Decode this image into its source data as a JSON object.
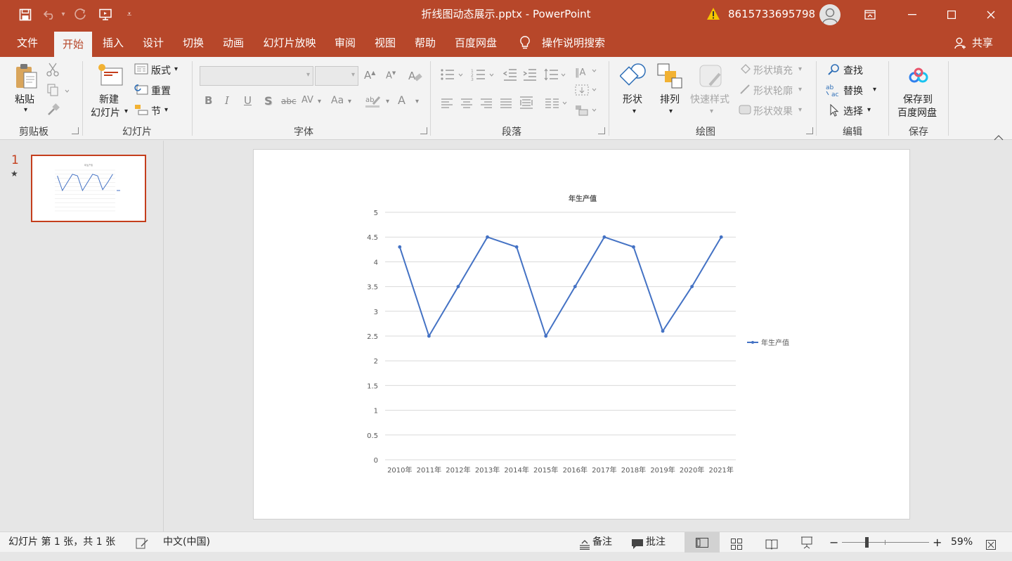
{
  "window": {
    "title": "折线图动态展示.pptx  -  PowerPoint",
    "account": "8615733695798"
  },
  "tabs": [
    "文件",
    "开始",
    "插入",
    "设计",
    "切换",
    "动画",
    "幻灯片放映",
    "审阅",
    "视图",
    "帮助",
    "百度网盘"
  ],
  "active_tab": "开始",
  "tell_me": "操作说明搜索",
  "share": "共享",
  "ribbon": {
    "clipboard": {
      "label": "剪贴板",
      "paste": "粘贴"
    },
    "slides": {
      "label": "幻灯片",
      "new_slide_1": "新建",
      "new_slide_2": "幻灯片",
      "layout": "版式",
      "reset": "重置",
      "section": "节"
    },
    "font": {
      "label": "字体",
      "bold": "B",
      "italic": "I",
      "underline": "U",
      "shadow": "S",
      "strike": "abc",
      "spacing": "AV",
      "case": "Aa",
      "font_color": "A"
    },
    "paragraph": {
      "label": "段落"
    },
    "drawing": {
      "label": "绘图",
      "shapes": "形状",
      "arrange": "排列",
      "quick_styles": "快速样式",
      "fill": "形状填充",
      "outline": "形状轮廓",
      "effects": "形状效果"
    },
    "editing": {
      "label": "编辑",
      "find": "查找",
      "replace": "替换",
      "select": "选择"
    },
    "save": {
      "label": "保存",
      "save_to_1": "保存到",
      "save_to_2": "百度网盘"
    }
  },
  "thumbnail": {
    "number": "1",
    "star": "★"
  },
  "chart_data": {
    "type": "line",
    "title": "年生产值",
    "categories": [
      "2010年",
      "2011年",
      "2012年",
      "2013年",
      "2014年",
      "2015年",
      "2016年",
      "2017年",
      "2018年",
      "2019年",
      "2020年",
      "2021年"
    ],
    "series": [
      {
        "name": "年生产值",
        "values": [
          4.3,
          2.5,
          3.5,
          4.5,
          4.3,
          2.5,
          3.5,
          4.5,
          4.3,
          2.6,
          3.5,
          4.5
        ]
      }
    ],
    "ylim": [
      0,
      5
    ],
    "yticks": [
      "0",
      "0.5",
      "1",
      "1.5",
      "2",
      "2.5",
      "3",
      "3.5",
      "4",
      "4.5",
      "5"
    ],
    "grid": true,
    "legend": "right",
    "color": "#4472c4"
  },
  "status": {
    "slide_info": "幻灯片 第 1 张，共 1 张",
    "language": "中文(中国)",
    "notes": "备注",
    "comments": "批注",
    "zoom": "59%",
    "minus": "−",
    "plus": "+"
  }
}
